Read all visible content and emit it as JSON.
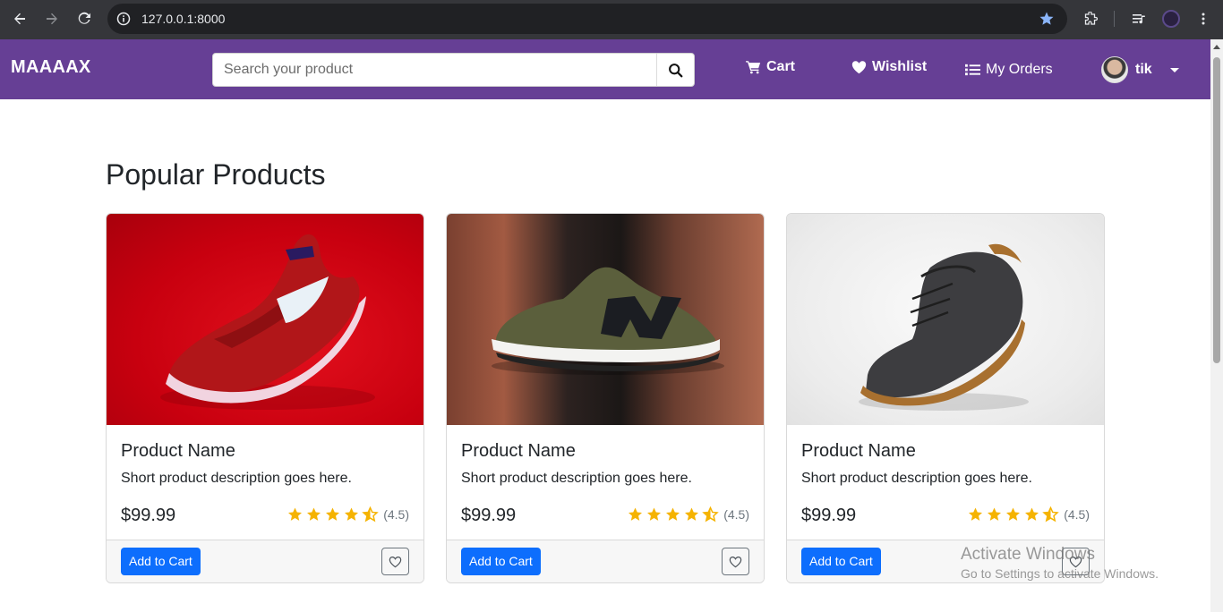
{
  "browser": {
    "url": "127.0.0.1:8000"
  },
  "navbar": {
    "brand": "MAAAAX",
    "search_placeholder": "Search your product",
    "cart_label": "Cart",
    "wishlist_label": "Wishlist",
    "orders_label": "My Orders",
    "user_name": "tik"
  },
  "main": {
    "title": "Popular Products",
    "products": [
      {
        "name": "Product Name",
        "description": "Short product description goes here.",
        "price": "$99.99",
        "rating": 4.5,
        "rating_text": "(4.5)",
        "image": "red-nike-sneaker",
        "add_label": "Add to Cart"
      },
      {
        "name": "Product Name",
        "description": "Short product description goes here.",
        "price": "$99.99",
        "rating": 4.5,
        "rating_text": "(4.5)",
        "image": "olive-new-balance-sneaker",
        "add_label": "Add to Cart"
      },
      {
        "name": "Product Name",
        "description": "Short product description goes here.",
        "price": "$99.99",
        "rating": 4.5,
        "rating_text": "(4.5)",
        "image": "grey-chukka-boot",
        "add_label": "Add to Cart"
      }
    ]
  },
  "watermark": {
    "line1": "Activate Windows",
    "line2": "Go to Settings to activate Windows."
  },
  "colors": {
    "navbar": "#663f95",
    "primary_button": "#0d6efd",
    "star": "#f5b301"
  }
}
